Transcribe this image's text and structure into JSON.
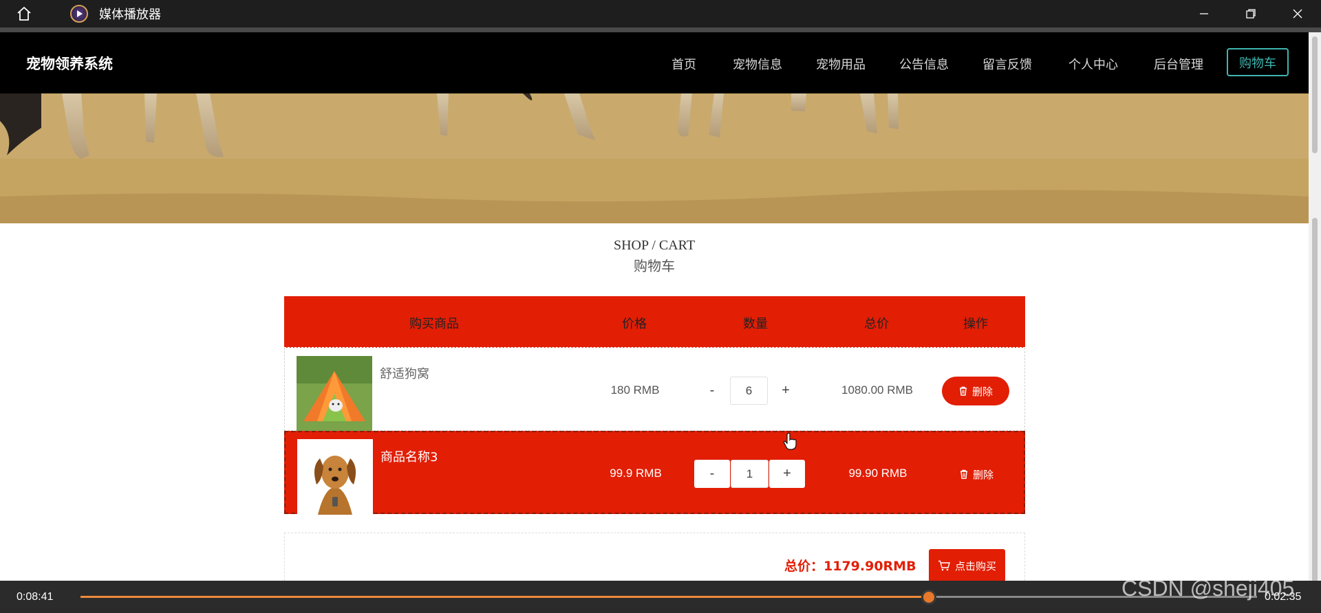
{
  "player": {
    "title": "媒体播放器",
    "current_time": "0:08:41",
    "total_time": "0:02:35",
    "progress": 0.721
  },
  "site": {
    "brand": "宠物领养系统",
    "nav": [
      "首页",
      "宠物信息",
      "宠物用品",
      "公告信息",
      "留言反馈",
      "个人中心",
      "后台管理"
    ],
    "cart_button": "购物车"
  },
  "carousel": {
    "active_index": 0,
    "count": 3
  },
  "section": {
    "title_en": "SHOP / CART",
    "title_cn": "购物车"
  },
  "cart": {
    "headers": {
      "product": "购买商品",
      "price": "价格",
      "qty": "数量",
      "subtotal": "总价",
      "action": "操作"
    },
    "rows": [
      {
        "name": "舒适狗窝",
        "price": "180 RMB",
        "qty": "6",
        "subtotal": "1080.00 RMB",
        "delete_label": "删除",
        "minus": "-",
        "plus": "+"
      },
      {
        "name": "商品名称3",
        "price": "99.9 RMB",
        "qty": "1",
        "subtotal": "99.90 RMB",
        "delete_label": "删除",
        "minus": "-",
        "plus": "+"
      }
    ],
    "total_label": "总价：1179.90RMB",
    "buy_label": "点击购买"
  },
  "watermark": "CSDN @sheji405",
  "colors": {
    "accent_red": "#e21e05",
    "teal": "#3fb6b0",
    "progress_orange": "#f08a3a"
  }
}
